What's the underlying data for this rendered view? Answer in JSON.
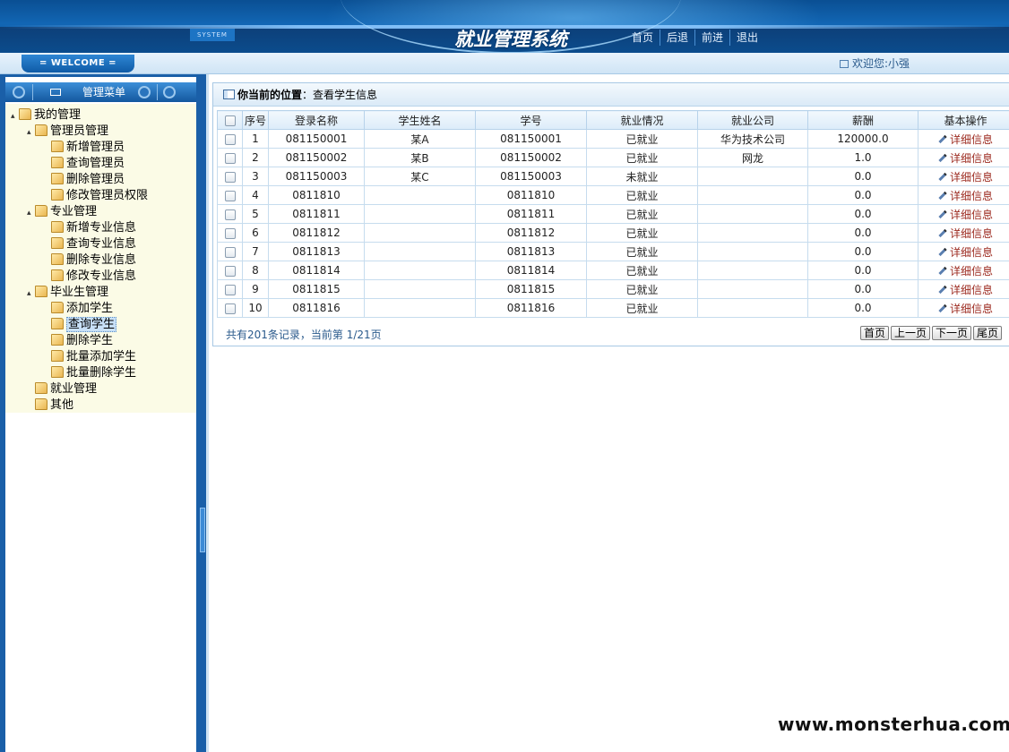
{
  "header": {
    "system_tag": "SYSTEM",
    "title": "就业管理系统",
    "nav": [
      "首页",
      "后退",
      "前进",
      "退出"
    ]
  },
  "subbar": {
    "welcome_label": "= WELCOME =",
    "welcome_user": "欢迎您:小强"
  },
  "menu": {
    "title": "管理菜单",
    "tree": [
      {
        "label": "我的管理",
        "level": 0
      },
      {
        "label": "管理员管理",
        "level": 1
      },
      {
        "label": "新增管理员",
        "level": 2
      },
      {
        "label": "查询管理员",
        "level": 2
      },
      {
        "label": "删除管理员",
        "level": 2
      },
      {
        "label": "修改管理员权限",
        "level": 2
      },
      {
        "label": "专业管理",
        "level": 1
      },
      {
        "label": "新增专业信息",
        "level": 2
      },
      {
        "label": "查询专业信息",
        "level": 2
      },
      {
        "label": "删除专业信息",
        "level": 2
      },
      {
        "label": "修改专业信息",
        "level": 2
      },
      {
        "label": "毕业生管理",
        "level": 1
      },
      {
        "label": "添加学生",
        "level": 2
      },
      {
        "label": "查询学生",
        "level": 2,
        "selected": true
      },
      {
        "label": "删除学生",
        "level": 2
      },
      {
        "label": "批量添加学生",
        "level": 2
      },
      {
        "label": "批量删除学生",
        "level": 2
      },
      {
        "label": "就业管理",
        "level": 1
      },
      {
        "label": "其他",
        "level": 1
      }
    ]
  },
  "location": {
    "prefix": "你当前的位置",
    "page": "：查看学生信息"
  },
  "table": {
    "headers": [
      "",
      "序号",
      "登录名称",
      "学生姓名",
      "学号",
      "就业情况",
      "就业公司",
      "薪酬",
      "基本操作"
    ],
    "action_label": "详细信息",
    "rows": [
      [
        "1",
        "081150001",
        "某A",
        "081150001",
        "已就业",
        "华为技术公司",
        "120000.0"
      ],
      [
        "2",
        "081150002",
        "某B",
        "081150002",
        "已就业",
        "网龙",
        "1.0"
      ],
      [
        "3",
        "081150003",
        "某C",
        "081150003",
        "未就业",
        "",
        "0.0"
      ],
      [
        "4",
        "0811810",
        "",
        "0811810",
        "已就业",
        "",
        "0.0"
      ],
      [
        "5",
        "0811811",
        "",
        "0811811",
        "已就业",
        "",
        "0.0"
      ],
      [
        "6",
        "0811812",
        "",
        "0811812",
        "已就业",
        "",
        "0.0"
      ],
      [
        "7",
        "0811813",
        "",
        "0811813",
        "已就业",
        "",
        "0.0"
      ],
      [
        "8",
        "0811814",
        "",
        "0811814",
        "已就业",
        "",
        "0.0"
      ],
      [
        "9",
        "0811815",
        "",
        "0811815",
        "已就业",
        "",
        "0.0"
      ],
      [
        "10",
        "0811816",
        "",
        "0811816",
        "已就业",
        "",
        "0.0"
      ]
    ]
  },
  "pager": {
    "summary": "共有201条记录，当前第 1/21页",
    "buttons": [
      "首页",
      "上一页",
      "下一页",
      "尾页"
    ]
  },
  "watermark": "www.monsterhua.com",
  "colors": {
    "header_blue": "#0c5aa6",
    "detail_link": "#9c2a1f",
    "tree_bg": "#fbfbe6"
  }
}
